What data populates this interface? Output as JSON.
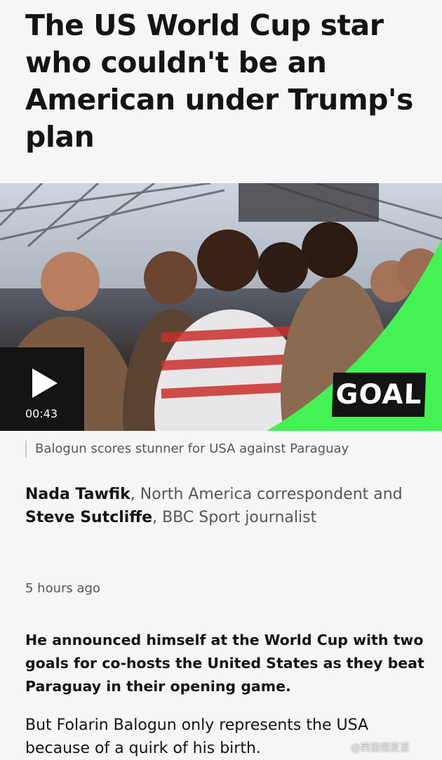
{
  "article": {
    "headline": "The US World Cup star who couldn't be an American under Trump's plan",
    "media": {
      "duration": "00:43",
      "logo_text": "GOAL",
      "caption": "Balogun scores stunner for USA against Paraguay",
      "play_icon": "play-icon"
    },
    "byline": {
      "author1": "Nada Tawfik",
      "author1_role": ", North America correspondent and ",
      "author2": "Steve Sutcliffe",
      "author2_role": ", BBC Sport journalist"
    },
    "timestamp": "5 hours ago",
    "intro": "He announced himself at the World Cup with two goals for co-hosts the United States as they beat Paraguay in their opening game.",
    "paragraph1": "But Folarin Balogun only represents the USA because of a quirk of his birth."
  },
  "watermark": "@西雅图夏至",
  "colors": {
    "accent_green": "#45f253",
    "text_primary": "#141414",
    "text_secondary": "#545658",
    "background": "#f6f6f6"
  }
}
